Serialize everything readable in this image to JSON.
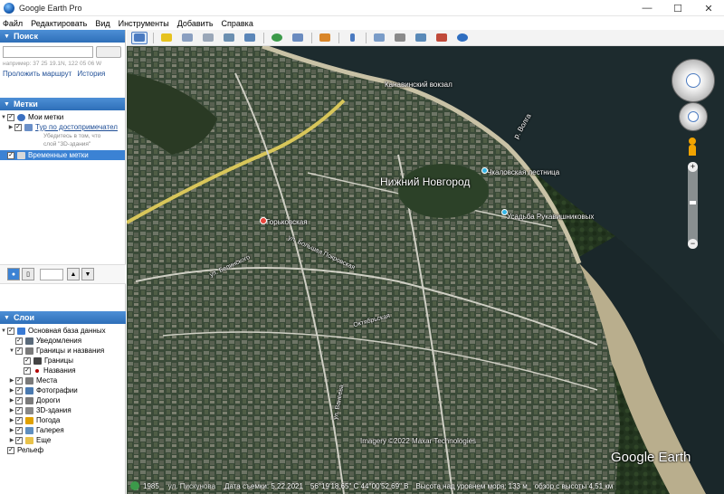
{
  "window": {
    "title": "Google Earth Pro",
    "minimize": "—",
    "maximize": "☐",
    "close": "✕"
  },
  "menu": [
    "Файл",
    "Редактировать",
    "Вид",
    "Инструменты",
    "Добавить",
    "Справка"
  ],
  "search": {
    "header": "Поиск",
    "placeholder": "",
    "hint": "например: 37 25 19.1N, 122 05 06 W",
    "route_link": "Проложить маршрут",
    "history_link": "История"
  },
  "places": {
    "header": "Метки",
    "my_places": "Мои метки",
    "tour": "Тур по достопримечател",
    "tour_note_1": "Убедитесь в том, что",
    "tour_note_2": "слой \"3D-здания\"",
    "temporary": "Временные метки"
  },
  "layers": {
    "header": "Слои",
    "items": [
      {
        "label": "Основная база данных",
        "level": 0,
        "icon": "globe-icon",
        "color": "#3a7bd5"
      },
      {
        "label": "Уведомления",
        "level": 1,
        "icon": "notice-icon",
        "color": "#5a6a7a"
      },
      {
        "label": "Границы и названия",
        "level": 1,
        "icon": "borders-icon",
        "color": "#7a7a7a"
      },
      {
        "label": "Границы",
        "level": 2,
        "icon": "flag-icon",
        "color": "#444"
      },
      {
        "label": "Названия",
        "level": 2,
        "icon": "dot-icon",
        "color": "#b00000"
      },
      {
        "label": "Места",
        "level": 1,
        "icon": "places-icon",
        "color": "#7a7a7a"
      },
      {
        "label": "Фотографии",
        "level": 1,
        "icon": "photo-icon",
        "color": "#4a7ab0"
      },
      {
        "label": "Дороги",
        "level": 1,
        "icon": "roads-icon",
        "color": "#7a7a7a"
      },
      {
        "label": "3D-здания",
        "level": 1,
        "icon": "buildings-icon",
        "color": "#888"
      },
      {
        "label": "Погода",
        "level": 1,
        "icon": "weather-icon",
        "color": "#e0a100"
      },
      {
        "label": "Галерея",
        "level": 1,
        "icon": "gallery-icon",
        "color": "#5f8fc0"
      },
      {
        "label": "Еще",
        "level": 1,
        "icon": "folder-icon",
        "color": "#e8c24a"
      },
      {
        "label": "Рельеф",
        "level": 0,
        "icon": "",
        "color": ""
      }
    ]
  },
  "map": {
    "labels": {
      "station": "Канавинский вокзал",
      "city": "Нижний Новгород",
      "stairs": "Чкаловская лестница",
      "estate": "Усадьба Рукавишниковых",
      "metro": "Горьковская",
      "river": "р. Волга",
      "street1": "ул. Белинского",
      "street2": "ул. Большая Покровская",
      "street3": "ул. Ванеева",
      "street4": "Октябрьская"
    },
    "imagery": "Imagery ©2022 Maxar Technologies",
    "logo": "Google Earth",
    "year": "1985",
    "date": "Дата съемки: 5.22.2021",
    "coords": "56°19'18.65\" С  44°00'52.69\" В",
    "elevation": "Высота над уровнем моря:   133 м",
    "eye": "обзор с высоты   4.51 км",
    "street_bottom": "ул. Пискунова"
  }
}
